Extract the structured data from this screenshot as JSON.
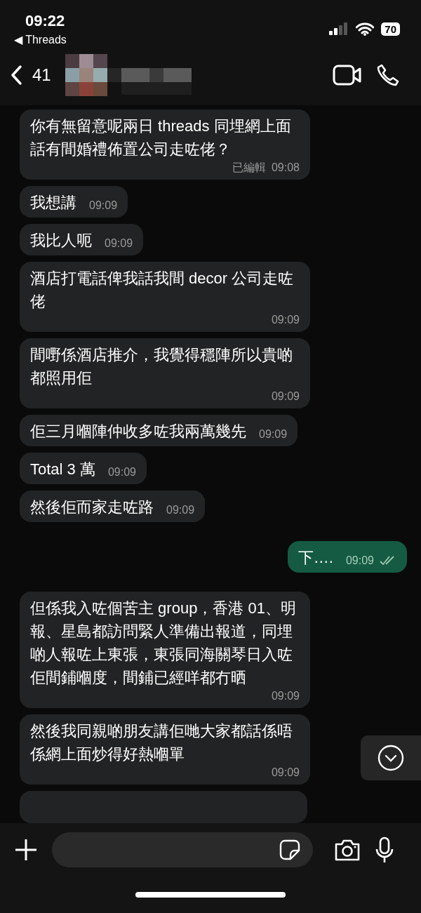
{
  "status_bar": {
    "time": "09:22",
    "back_app": "◀ Threads",
    "battery": "70"
  },
  "header": {
    "unread_count": "41"
  },
  "messages": [
    {
      "text": "你有無留意呢兩日 threads 同埋網上面話有間婚禮佈置公司走咗佬？",
      "time": "09:08",
      "edited": "已編輯",
      "outgoing": false
    },
    {
      "text": "我想講",
      "time": "09:09",
      "outgoing": false
    },
    {
      "text": "我比人呃",
      "time": "09:09",
      "outgoing": false
    },
    {
      "text": "酒店打電話俾我話我間 decor 公司走咗佬",
      "time": "09:09",
      "outgoing": false
    },
    {
      "text": "間嘢係酒店推介，我覺得穩陣所以貴啲都照用佢",
      "time": "09:09",
      "outgoing": false
    },
    {
      "text": "佢三月嗰陣仲收多咗我兩萬幾先",
      "time": "09:09",
      "outgoing": false
    },
    {
      "text": "Total 3 萬",
      "time": "09:09",
      "outgoing": false
    },
    {
      "text": "然後佢而家走咗路",
      "time": "09:09",
      "outgoing": false
    },
    {
      "text": "下….",
      "time": "09:09",
      "outgoing": true,
      "read": true
    },
    {
      "text": "但係我入咗個苦主 group，香港 01、明報、星島都訪問緊人準備出報道，同埋啲人報咗上東張，東張同海關琴日入咗佢間鋪嗰度，間鋪已經咩都冇晒",
      "time": "09:09",
      "outgoing": false
    },
    {
      "text": "然後我同親啲朋友講佢哋大家都話係唔係網上面炒得好熱嗰單",
      "time": "09:09",
      "outgoing": false
    }
  ]
}
